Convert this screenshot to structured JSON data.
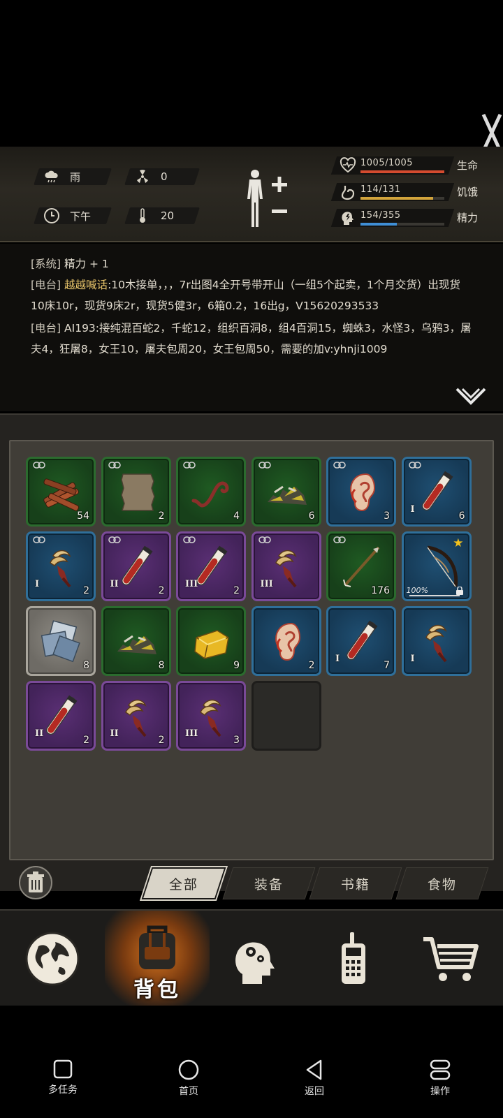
{
  "status": {
    "weather": {
      "label": "雨",
      "icon": "rain-cloud-icon"
    },
    "radiation": {
      "value": "0",
      "icon": "radiation-icon"
    },
    "time": {
      "label": "下午",
      "icon": "clock-icon"
    },
    "temperature": {
      "value": "20",
      "icon": "thermometer-icon"
    },
    "bars": [
      {
        "text": "1005/1005",
        "label": "生命",
        "icon": "heart-icon",
        "fill": 1.0,
        "color": "#d44b2f"
      },
      {
        "text": "114/131",
        "label": "饥饿",
        "icon": "stomach-icon",
        "fill": 0.87,
        "color": "#d2a43c"
      },
      {
        "text": "154/355",
        "label": "精力",
        "icon": "energy-head-icon",
        "fill": 0.43,
        "color": "#3f8fd6"
      }
    ]
  },
  "log": {
    "line1": {
      "tag": "[系统]",
      "text": " 精力 + 1"
    },
    "line2": {
      "tag": "[电台]",
      "sender": "越越喊话",
      "text": ":10木接单，，，7r出图4全开号带开山（一组5个起卖，1个月交货）出现货10床10r，现货9床2r，现货5健3r，6箱0.2，16出g，V15620293533"
    },
    "line3": {
      "tag": "[电台]",
      "text": " AI193:接纯混百蛇2，千蛇12，组织百洞8，组4百洞15，蜘蛛3，水怪3，乌鸦3，屠夫4，狂屠8，女王10，屠夫包周20，女王包周50，需要的加v:yhnji1009"
    }
  },
  "inventory": {
    "slots": [
      {
        "rarity": "green",
        "item": "wood-logs-icon",
        "qty": "54",
        "link": true
      },
      {
        "rarity": "green",
        "item": "leather-hide-icon",
        "qty": "2",
        "link": true
      },
      {
        "rarity": "green",
        "item": "rope-hook-icon",
        "qty": "4",
        "link": true
      },
      {
        "rarity": "green",
        "item": "scrap-pile-icon",
        "qty": "6",
        "link": true
      },
      {
        "rarity": "blue",
        "item": "ear-icon",
        "qty": "3",
        "link": true
      },
      {
        "rarity": "blue",
        "item": "blood-vial-icon",
        "qty": "6",
        "tier": "I",
        "link": true
      },
      {
        "rarity": "blue",
        "item": "claw-icon",
        "qty": "2",
        "tier": "I",
        "link": true
      },
      {
        "rarity": "purple",
        "item": "blood-vial-icon",
        "qty": "2",
        "tier": "II",
        "link": true
      },
      {
        "rarity": "purple",
        "item": "blood-vial-icon",
        "qty": "2",
        "tier": "III",
        "link": true
      },
      {
        "rarity": "purple",
        "item": "claw-icon",
        "qty": "",
        "tier": "III",
        "link": true
      },
      {
        "rarity": "green",
        "item": "arrow-shaft-icon",
        "qty": "176",
        "link": true
      },
      {
        "rarity": "blue",
        "item": "bow-icon",
        "qty": "",
        "durability": "100%",
        "star": true,
        "locked": true
      },
      {
        "rarity": "gray",
        "item": "cloth-icon",
        "qty": "8"
      },
      {
        "rarity": "green",
        "item": "scrap-pile-icon",
        "qty": "8"
      },
      {
        "rarity": "green",
        "item": "gold-ingot-icon",
        "qty": "9"
      },
      {
        "rarity": "blue",
        "item": "ear-icon",
        "qty": "2"
      },
      {
        "rarity": "blue",
        "item": "blood-vial-icon",
        "qty": "7",
        "tier": "I"
      },
      {
        "rarity": "blue",
        "item": "claw-icon",
        "qty": "",
        "tier": "I"
      },
      {
        "rarity": "purple",
        "item": "blood-vial-icon",
        "qty": "2",
        "tier": "II"
      },
      {
        "rarity": "purple",
        "item": "claw-icon",
        "qty": "2",
        "tier": "II"
      },
      {
        "rarity": "purple",
        "item": "claw-icon",
        "qty": "3",
        "tier": "III"
      },
      {
        "rarity": "empty",
        "item": "",
        "qty": ""
      }
    ]
  },
  "tabs": [
    "全部",
    "装备",
    "书籍",
    "食物"
  ],
  "nav": {
    "items": [
      {
        "icon": "globe-icon"
      },
      {
        "icon": "backpack-icon",
        "label": "背包",
        "active": true
      },
      {
        "icon": "head-gears-icon"
      },
      {
        "icon": "radio-icon"
      },
      {
        "icon": "cart-icon"
      }
    ]
  },
  "system_bar": {
    "multitask": "多任务",
    "home": "首页",
    "back": "返回",
    "operate": "操作"
  }
}
